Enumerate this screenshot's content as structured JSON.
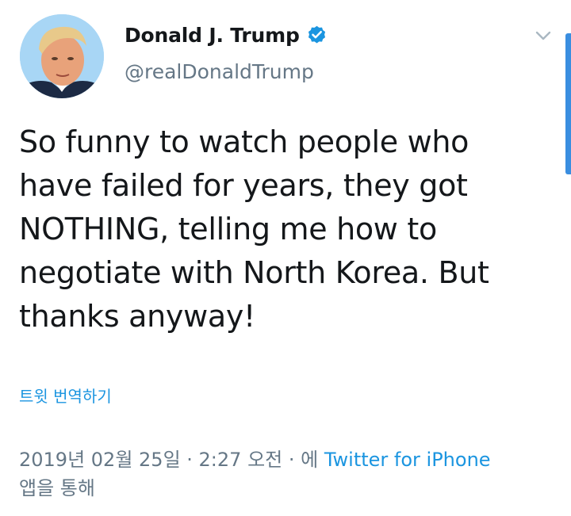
{
  "user": {
    "display_name": "Donald J. Trump",
    "handle": "@realDonaldTrump",
    "verified_icon": "verified-badge-icon",
    "avatar_icon": "profile-photo"
  },
  "tweet": {
    "lines": [
      "So funny to watch people who",
      "have failed for years, they got",
      "NOTHING, telling me how to",
      "negotiate with North Korea. But",
      "thanks anyway!"
    ],
    "translate_label": "트윗 번역하기"
  },
  "meta": {
    "timestamp": "2019년 02월 25일 · 2:27 오전 · 에",
    "source": "Twitter for iPhone",
    "suffix": "앱을 통해"
  },
  "colors": {
    "link": "#1b95e0",
    "secondary": "#657786",
    "primary_text": "#14171a",
    "scroll_indicator": "#3a8ee0"
  },
  "menu_icon": "chevron-down-icon"
}
